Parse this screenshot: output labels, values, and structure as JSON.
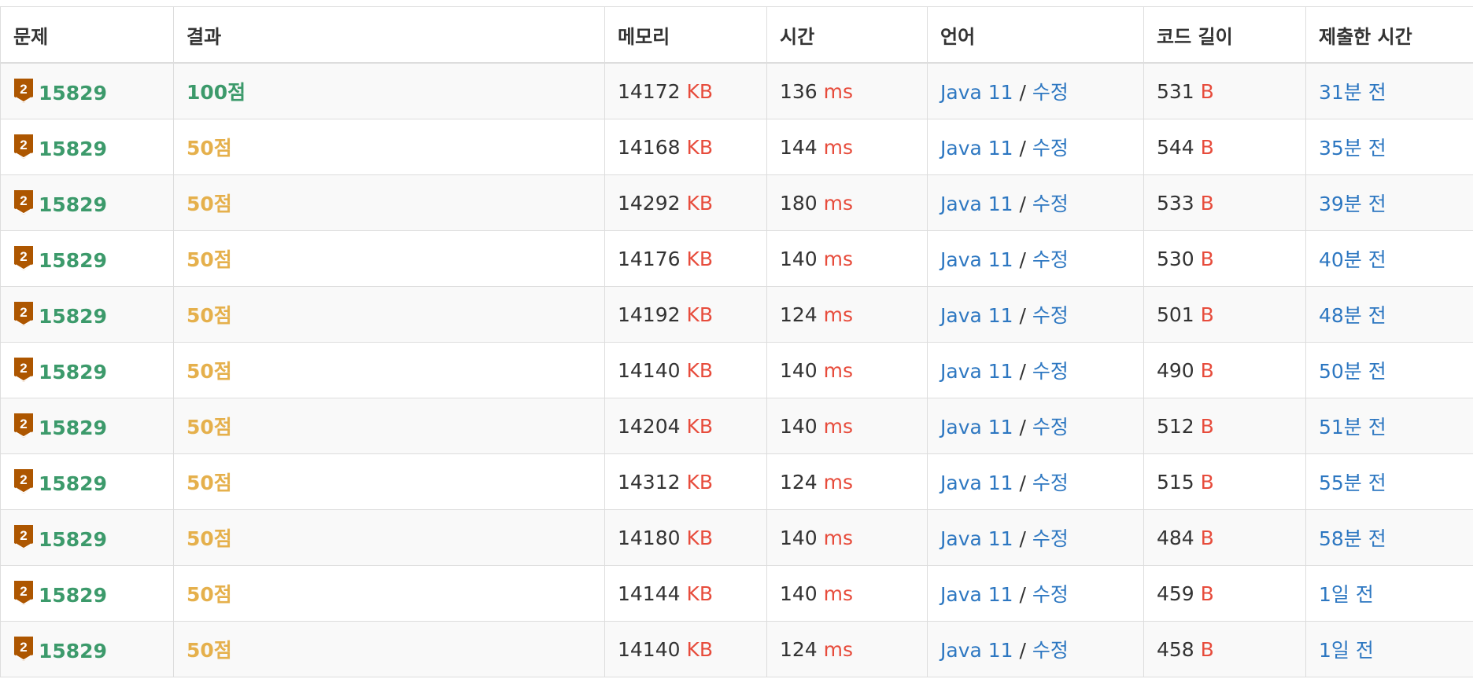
{
  "headers": {
    "problem": "문제",
    "result": "결과",
    "memory": "메모리",
    "time": "시간",
    "language": "언어",
    "code_length": "코드 길이",
    "submitted_at": "제출한 시간"
  },
  "units": {
    "memory": "KB",
    "time": "ms",
    "length": "B"
  },
  "separator": "/",
  "colors": {
    "success": "#3c9a6b",
    "partial": "#e5b04c",
    "unit": "#e74c3c",
    "link": "#2d77c1",
    "tier_badge": "#ad5600"
  },
  "tier_icon": "bronze-2-tier-icon",
  "tier_number": "2",
  "rows": [
    {
      "problem": "15829",
      "result": "100점",
      "full": true,
      "memory": "14172",
      "time": "136",
      "language": "Java 11",
      "edit": "수정",
      "length": "531",
      "submitted": "31분 전"
    },
    {
      "problem": "15829",
      "result": "50점",
      "full": false,
      "memory": "14168",
      "time": "144",
      "language": "Java 11",
      "edit": "수정",
      "length": "544",
      "submitted": "35분 전"
    },
    {
      "problem": "15829",
      "result": "50점",
      "full": false,
      "memory": "14292",
      "time": "180",
      "language": "Java 11",
      "edit": "수정",
      "length": "533",
      "submitted": "39분 전"
    },
    {
      "problem": "15829",
      "result": "50점",
      "full": false,
      "memory": "14176",
      "time": "140",
      "language": "Java 11",
      "edit": "수정",
      "length": "530",
      "submitted": "40분 전"
    },
    {
      "problem": "15829",
      "result": "50점",
      "full": false,
      "memory": "14192",
      "time": "124",
      "language": "Java 11",
      "edit": "수정",
      "length": "501",
      "submitted": "48분 전"
    },
    {
      "problem": "15829",
      "result": "50점",
      "full": false,
      "memory": "14140",
      "time": "140",
      "language": "Java 11",
      "edit": "수정",
      "length": "490",
      "submitted": "50분 전"
    },
    {
      "problem": "15829",
      "result": "50점",
      "full": false,
      "memory": "14204",
      "time": "140",
      "language": "Java 11",
      "edit": "수정",
      "length": "512",
      "submitted": "51분 전"
    },
    {
      "problem": "15829",
      "result": "50점",
      "full": false,
      "memory": "14312",
      "time": "124",
      "language": "Java 11",
      "edit": "수정",
      "length": "515",
      "submitted": "55분 전"
    },
    {
      "problem": "15829",
      "result": "50점",
      "full": false,
      "memory": "14180",
      "time": "140",
      "language": "Java 11",
      "edit": "수정",
      "length": "484",
      "submitted": "58분 전"
    },
    {
      "problem": "15829",
      "result": "50점",
      "full": false,
      "memory": "14144",
      "time": "140",
      "language": "Java 11",
      "edit": "수정",
      "length": "459",
      "submitted": "1일 전"
    },
    {
      "problem": "15829",
      "result": "50점",
      "full": false,
      "memory": "14140",
      "time": "124",
      "language": "Java 11",
      "edit": "수정",
      "length": "458",
      "submitted": "1일 전"
    }
  ]
}
